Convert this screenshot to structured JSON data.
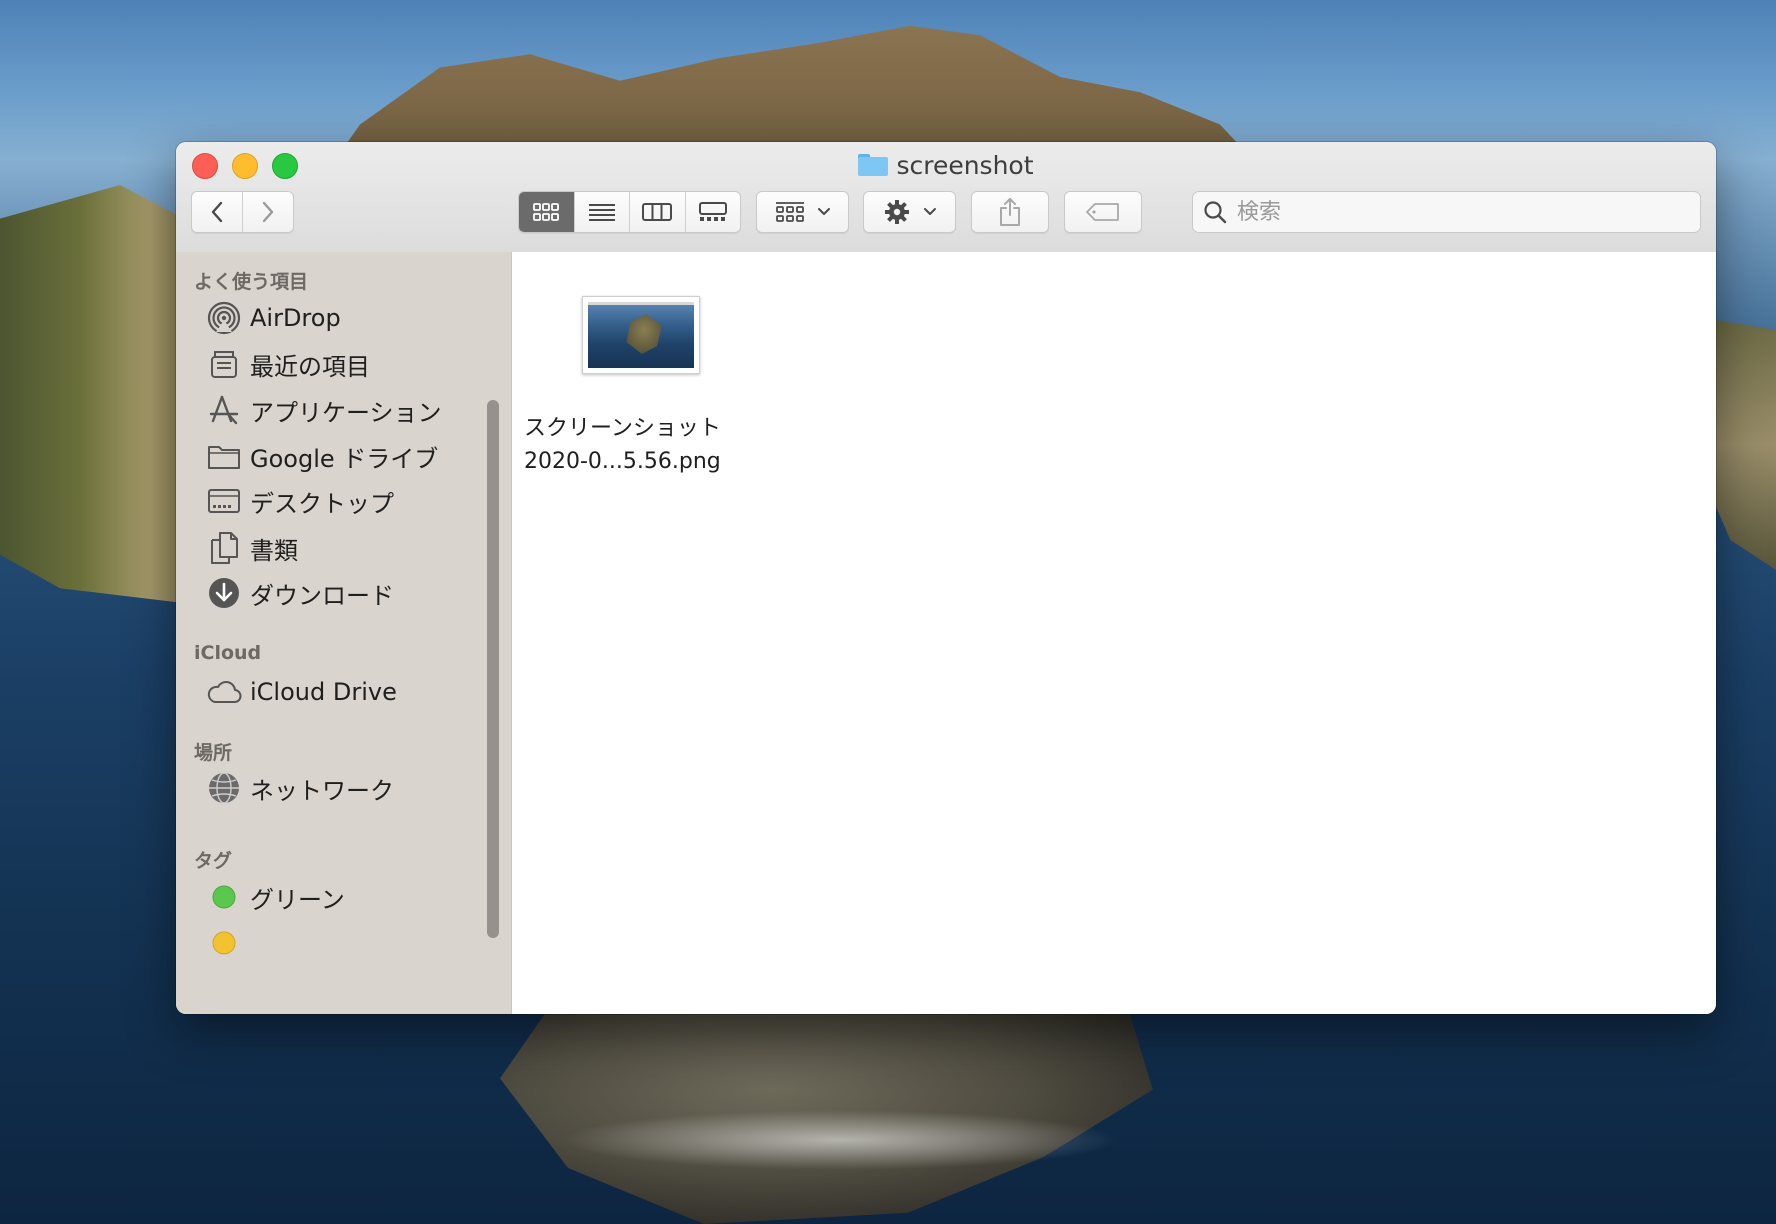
{
  "window": {
    "title": "screenshot",
    "icon": "folder-icon"
  },
  "toolbar": {
    "back": "chevron-left-icon",
    "forward": "chevron-right-icon",
    "views": [
      "icon-view",
      "list-view",
      "column-view",
      "gallery-view"
    ],
    "active_view": "icon-view",
    "arrange": "group-icon",
    "action": "gear-icon",
    "share": "share-icon",
    "tag": "tag-icon"
  },
  "search": {
    "placeholder": "検索",
    "value": ""
  },
  "sidebar": {
    "favorites_header": "よく使う項目",
    "favorites": [
      {
        "label": "AirDrop",
        "icon": "airdrop-icon"
      },
      {
        "label": "最近の項目",
        "icon": "recents-icon"
      },
      {
        "label": "アプリケーション",
        "icon": "applications-icon"
      },
      {
        "label": "Google ドライブ",
        "icon": "folder-icon"
      },
      {
        "label": "デスクトップ",
        "icon": "desktop-icon"
      },
      {
        "label": "書類",
        "icon": "documents-icon"
      },
      {
        "label": "ダウンロード",
        "icon": "downloads-icon"
      }
    ],
    "icloud_header": "iCloud",
    "icloud": [
      {
        "label": "iCloud Drive",
        "icon": "cloud-icon"
      }
    ],
    "locations_header": "場所",
    "locations": [
      {
        "label": "ネットワーク",
        "icon": "network-icon"
      }
    ],
    "tags_header": "タグ",
    "tags": [
      {
        "label": "グリーン",
        "color": "#5ac74e"
      },
      {
        "label": "",
        "color": "#f2c231"
      }
    ]
  },
  "files": [
    {
      "name_line1": "スクリーンショット",
      "name_line2": "2020-0...5.56.png"
    }
  ],
  "colors": {
    "close": "#fd5f57",
    "minimize": "#febc2e",
    "maximize": "#29c840",
    "sidebar_bg": "#d9d4cd",
    "active_segment": "#6b6b6b"
  }
}
